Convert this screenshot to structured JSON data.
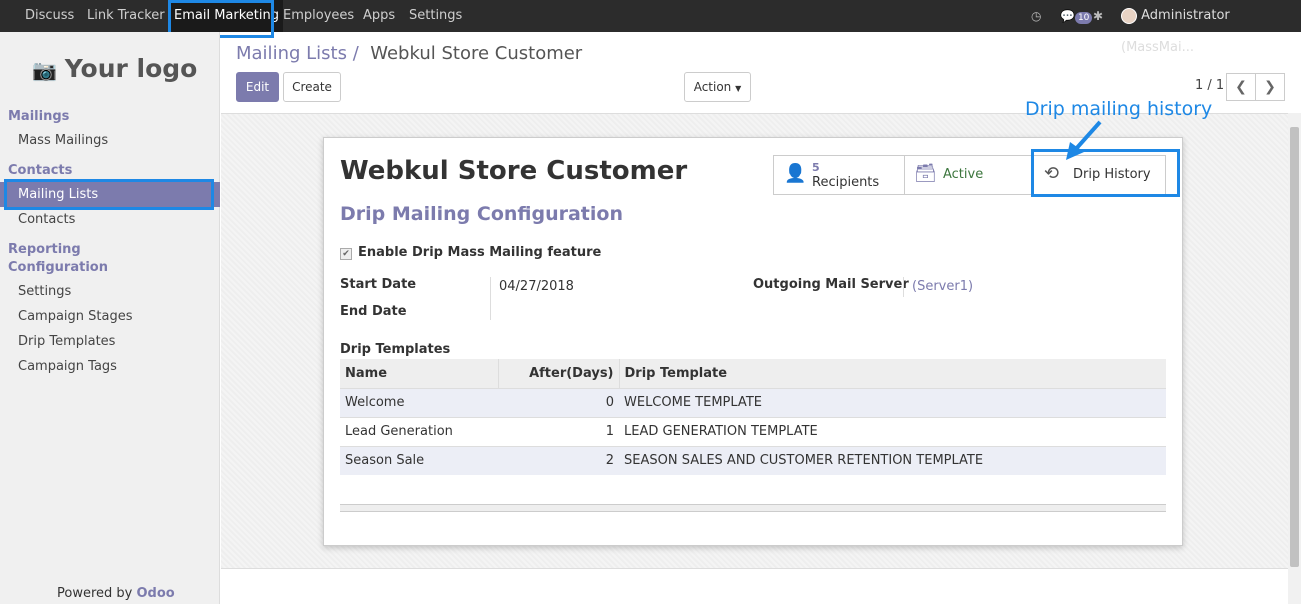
{
  "topbar": {
    "menu": [
      "Discuss",
      "Link Tracker",
      "Email Marketing",
      "Employees",
      "Apps",
      "Settings"
    ],
    "active": "Email Marketing",
    "message_count": "10",
    "user": "Administrator (MassMai..."
  },
  "sidebar": {
    "logo_text": "Your logo",
    "sections": [
      {
        "title": "Mailings",
        "items": [
          "Mass Mailings"
        ]
      },
      {
        "title": "Contacts",
        "items": [
          "Mailing Lists",
          "Contacts"
        ]
      },
      {
        "title": "Reporting",
        "items": []
      },
      {
        "title": "Configuration",
        "items": [
          "Settings",
          "Campaign Stages",
          "Drip Templates",
          "Campaign Tags"
        ]
      }
    ],
    "active_item": "Mailing Lists",
    "powered_by": "Powered by",
    "powered_brand": "Odoo"
  },
  "control_panel": {
    "breadcrumb_parent": "Mailing Lists",
    "breadcrumb_sep": "/",
    "breadcrumb_current": "Webkul Store Customer",
    "edit_label": "Edit",
    "create_label": "Create",
    "action_label": "Action",
    "pager": "1 / 1"
  },
  "form": {
    "name": "Webkul Store Customer",
    "section_title": "Drip Mailing Configuration",
    "enable_drip_label": "Enable Drip Mass Mailing feature",
    "enable_drip_checked": true,
    "start_date_label": "Start Date",
    "start_date": "04/27/2018",
    "end_date_label": "End Date",
    "end_date": "",
    "outgoing_server_label": "Outgoing Mail Server",
    "outgoing_server": "(Server1)",
    "stat_buttons": {
      "recipients_count": "5",
      "recipients_label": "Recipients",
      "active_label": "Active",
      "drip_history_label": "Drip History"
    },
    "templates_label": "Drip Templates",
    "templates_headers": [
      "Name",
      "After(Days)",
      "Drip Template"
    ],
    "templates_rows": [
      [
        "Welcome",
        "0",
        "WELCOME TEMPLATE"
      ],
      [
        "Lead Generation",
        "1",
        "LEAD GENERATION TEMPLATE"
      ],
      [
        "Season Sale",
        "2",
        "SEASON SALES AND CUSTOMER RETENTION TEMPLATE"
      ]
    ]
  },
  "annotation": {
    "callout": "Drip mailing history",
    "color": "#1e88e5"
  },
  "colors": {
    "brand": "#7c7bad",
    "topbar": "#2c2c2c",
    "active_green": "#3c763d"
  }
}
